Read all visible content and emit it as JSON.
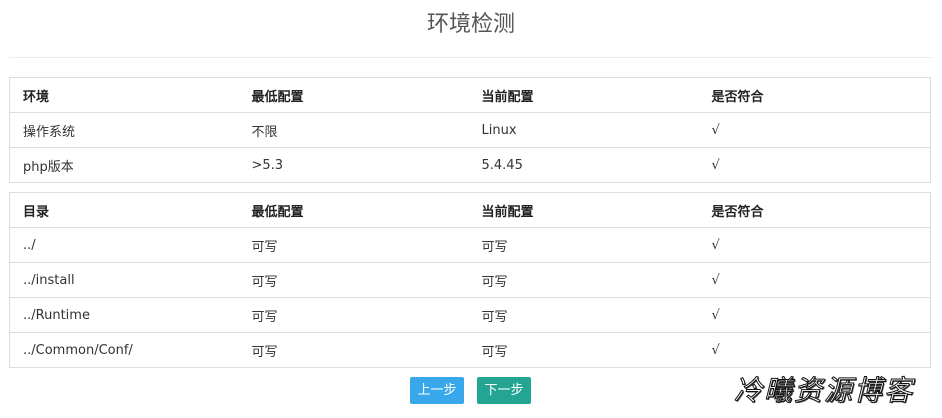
{
  "page": {
    "title": "环境检测"
  },
  "env_table": {
    "headers": [
      "环境",
      "最低配置",
      "当前配置",
      "是否符合"
    ],
    "rows": [
      [
        "操作系统",
        "不限",
        "Linux",
        "√"
      ],
      [
        "php版本",
        ">5.3",
        "5.4.45",
        "√"
      ]
    ]
  },
  "dir_table": {
    "headers": [
      "目录",
      "最低配置",
      "当前配置",
      "是否符合"
    ],
    "rows": [
      [
        "../",
        "可写",
        "可写",
        "√"
      ],
      [
        "../install",
        "可写",
        "可写",
        "√"
      ],
      [
        "../Runtime",
        "可写",
        "可写",
        "√"
      ],
      [
        "../Common/Conf/",
        "可写",
        "可写",
        "√"
      ]
    ]
  },
  "buttons": {
    "prev_label": "上一步",
    "next_label": "下一步"
  },
  "watermark": {
    "text": "冷曦资源博客"
  },
  "colors": {
    "prev_button": "#39a8ea",
    "next_button": "#24a493",
    "border": "#dddddd"
  }
}
